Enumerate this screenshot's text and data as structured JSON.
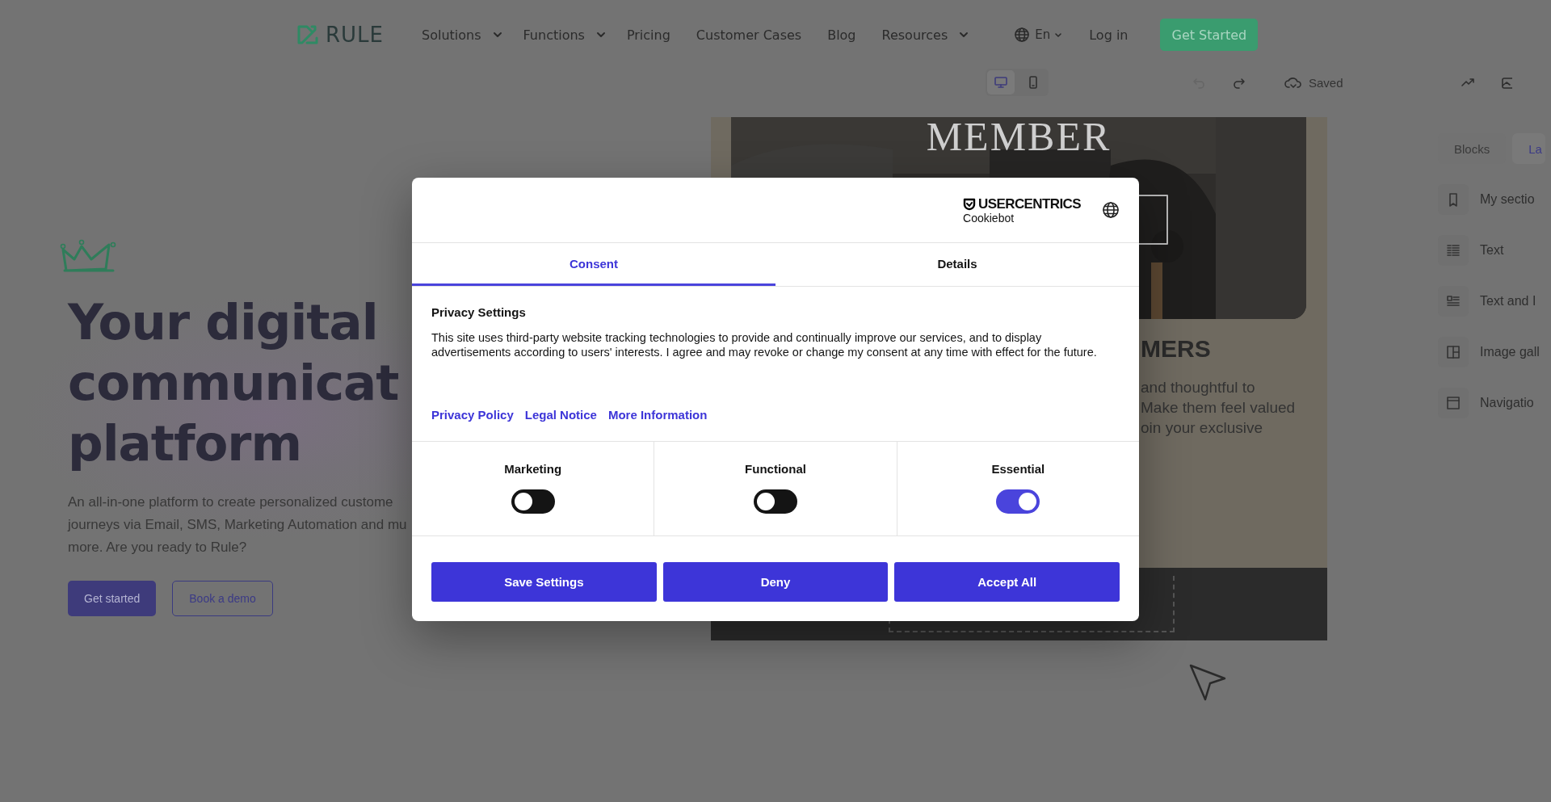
{
  "header": {
    "logo": "RULE",
    "nav": [
      {
        "label": "Solutions",
        "dropdown": true
      },
      {
        "label": "Functions",
        "dropdown": true
      },
      {
        "label": "Pricing",
        "dropdown": false
      },
      {
        "label": "Customer Cases",
        "dropdown": false
      },
      {
        "label": "Blog",
        "dropdown": false
      },
      {
        "label": "Resources",
        "dropdown": true
      }
    ],
    "language": "En",
    "login": "Log in",
    "cta": "Get Started"
  },
  "hero": {
    "heading_lines": [
      "Your digital",
      "communicat",
      "platform"
    ],
    "description": "An all-in-one platform to create personalized custome\njourneys via Email, SMS, Marketing Automation and mu\nmore. Are you ready to Rule?",
    "buttons": [
      {
        "label": "Get started",
        "kind": "primary"
      },
      {
        "label": "Book a demo",
        "kind": "outline"
      }
    ]
  },
  "editor": {
    "toolbar": {
      "devices": [
        {
          "kind": "desktop",
          "selected": true
        },
        {
          "kind": "mobile",
          "selected": false
        }
      ],
      "history": [
        {
          "kind": "undo",
          "disabled": true
        },
        {
          "kind": "redo",
          "disabled": false
        }
      ],
      "save_status": "Saved"
    },
    "preview": {
      "title": "MEMBER",
      "heading": "MERS",
      "text_lines": [
        "and thoughtful to",
        "Make them feel valued",
        "oin your exclusive"
      ]
    },
    "panel": {
      "tabs": [
        {
          "label": "Blocks",
          "selected": false
        },
        {
          "label": "La",
          "selected": true
        }
      ],
      "items": [
        {
          "label": "My sectio",
          "kind": "bookmark"
        },
        {
          "label": "Text",
          "kind": "text"
        },
        {
          "label": "Text and I",
          "kind": "text-image"
        },
        {
          "label": "Image gall",
          "kind": "gallery"
        },
        {
          "label": "Navigatio",
          "kind": "navigation"
        }
      ]
    }
  },
  "cookie_dialog": {
    "brand": "USERCENTRICS",
    "product": "Cookiebot",
    "tabs": [
      {
        "label": "Consent",
        "selected": true
      },
      {
        "label": "Details",
        "selected": false
      }
    ],
    "title": "Privacy Settings",
    "text": "This site uses third-party website tracking technologies to provide and continually improve our services, and to display advertisements according to users' interests. I agree and may revoke or change my consent at any time with effect for the future.",
    "links": [
      "Privacy Policy",
      "Legal Notice",
      "More Information"
    ],
    "categories": [
      {
        "label": "Marketing",
        "on": false
      },
      {
        "label": "Functional",
        "on": false
      },
      {
        "label": "Essential",
        "on": true
      }
    ],
    "buttons": [
      "Save Settings",
      "Deny",
      "Accept All"
    ]
  }
}
